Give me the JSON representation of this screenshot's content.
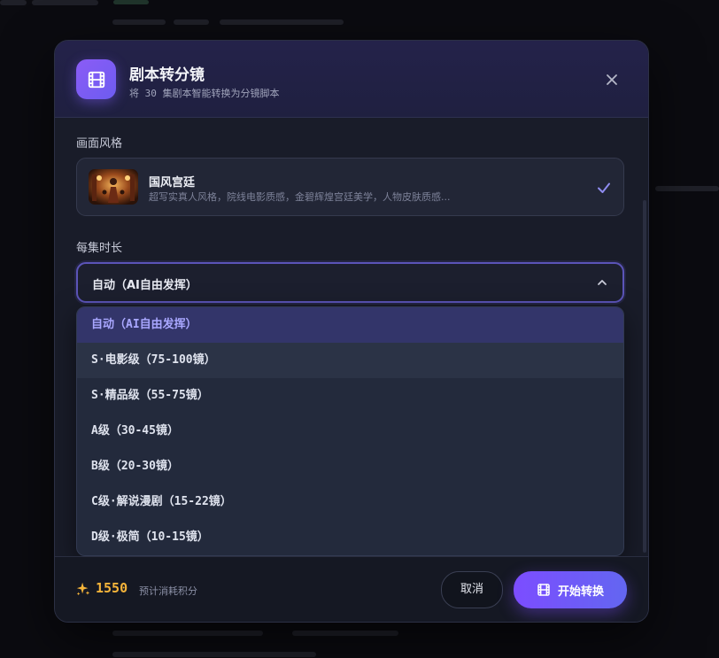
{
  "modal": {
    "title": "剧本转分镜",
    "subtitle": "将 30 集剧本智能转换为分镜脚本"
  },
  "style_section": {
    "label": "画面风格",
    "selected_style": {
      "name": "国风宫廷",
      "description": "超写实真人风格，院线电影质感，金碧辉煌宫廷美学，人物皮肤质感..."
    }
  },
  "duration_section": {
    "label": "每集时长",
    "selected_value": "自动（AI自由发挥）",
    "options": [
      "自动（AI自由发挥）",
      "S·电影级（75-100镜）",
      "S·精品级（55-75镜）",
      "A级（30-45镜）",
      "B级（20-30镜）",
      "C级·解说漫剧（15-22镜）",
      "D级·极简（10-15镜）"
    ],
    "selected_index": 0,
    "hover_index": 1
  },
  "footer": {
    "points_value": "1550",
    "points_label": "预计消耗积分",
    "cancel_label": "取消",
    "start_label": "开始转换"
  },
  "colors": {
    "accent": "#7c4dff",
    "points": "#f5b43a",
    "selected_option_text": "#a9a7ff"
  },
  "icons": {
    "header": "film-icon",
    "close": "close-icon",
    "check": "check-icon",
    "chevron": "chevron-up-icon",
    "points": "sparkles-icon",
    "start": "film-icon"
  }
}
